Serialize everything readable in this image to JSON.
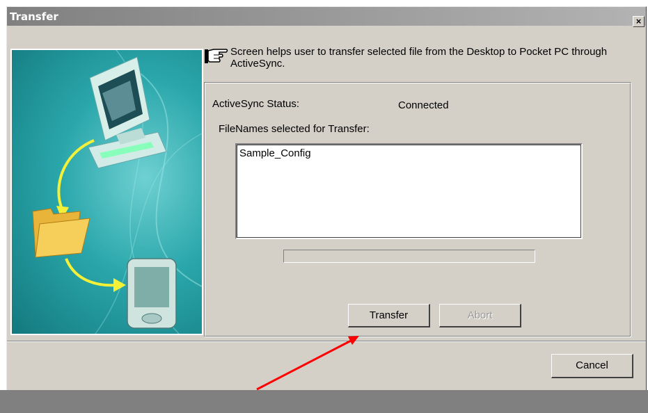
{
  "window": {
    "title": "Transfer",
    "close_label": "×"
  },
  "info": {
    "text": "Screen helps user to transfer selected file from the Desktop to Pocket PC through ActiveSync."
  },
  "status": {
    "label": "ActiveSync Status:",
    "value": "Connected"
  },
  "files": {
    "label": "FileNames selected for Transfer:",
    "items": [
      "Sample_Config"
    ]
  },
  "progress": {
    "value": 0
  },
  "buttons": {
    "transfer": "Transfer",
    "abort": "Abort",
    "cancel": "Cancel"
  },
  "icons": {
    "hand": "pointing-hand-icon",
    "computer": "desktop-computer-icon",
    "folder": "folder-icon",
    "pda": "pocket-pc-icon"
  },
  "colors": {
    "annotation_arrow": "#ff0000",
    "illustration_bg": "#2aa7ab"
  }
}
